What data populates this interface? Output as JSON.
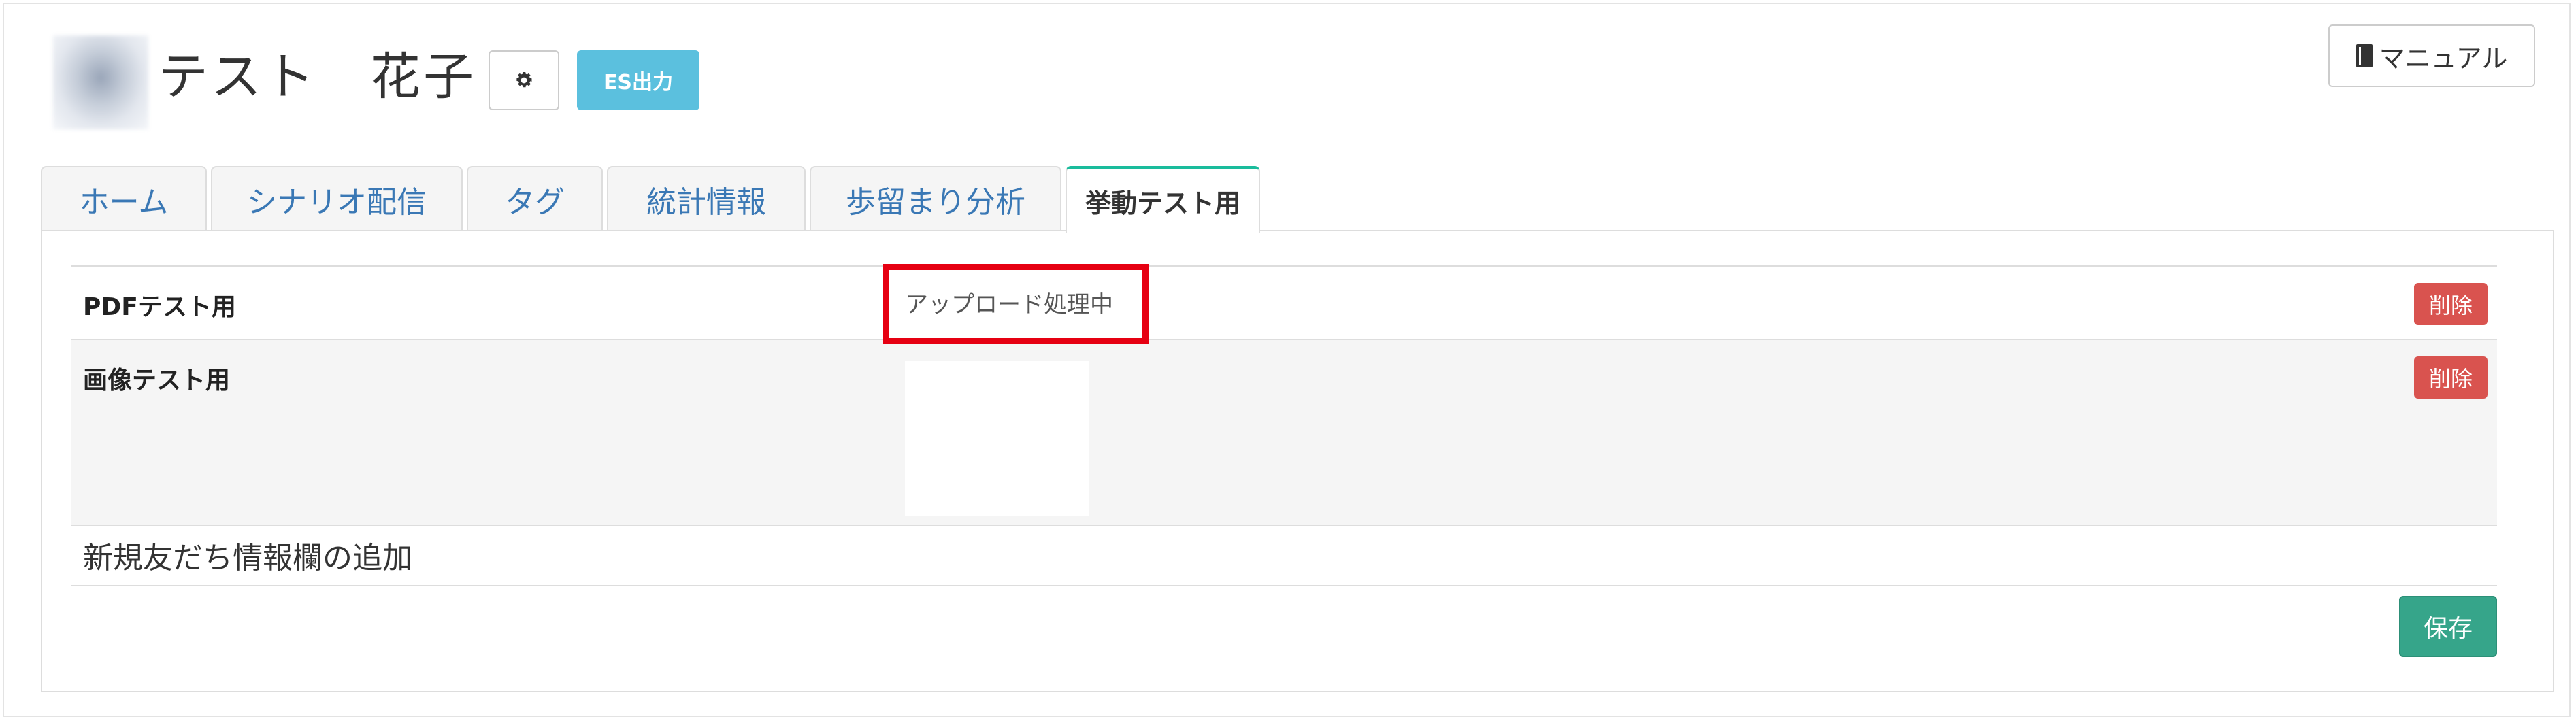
{
  "header": {
    "user_name": "テスト　花子",
    "es_export_label": "ES出力",
    "manual_label": "マニュアル"
  },
  "tabs": [
    {
      "label": "ホーム",
      "active": false
    },
    {
      "label": "シナリオ配信",
      "active": false
    },
    {
      "label": "タグ",
      "active": false
    },
    {
      "label": "統計情報",
      "active": false
    },
    {
      "label": "歩留まり分析",
      "active": false
    },
    {
      "label": "挙動テスト用",
      "active": true
    }
  ],
  "fields": [
    {
      "label": "PDFテスト用",
      "value": "アップロード処理中",
      "delete_label": "削除"
    },
    {
      "label": "画像テスト用",
      "value": "",
      "delete_label": "削除"
    }
  ],
  "add_field_label": "新規友だち情報欄の追加",
  "save_label": "保存",
  "colors": {
    "accent_tab": "#1abc9c",
    "es_button": "#5bc0de",
    "delete_button": "#d9534f",
    "save_button": "#36a58a",
    "highlight": "#e60012",
    "link": "#3a78b5"
  },
  "icons": [
    "gear-icon",
    "book-icon"
  ]
}
